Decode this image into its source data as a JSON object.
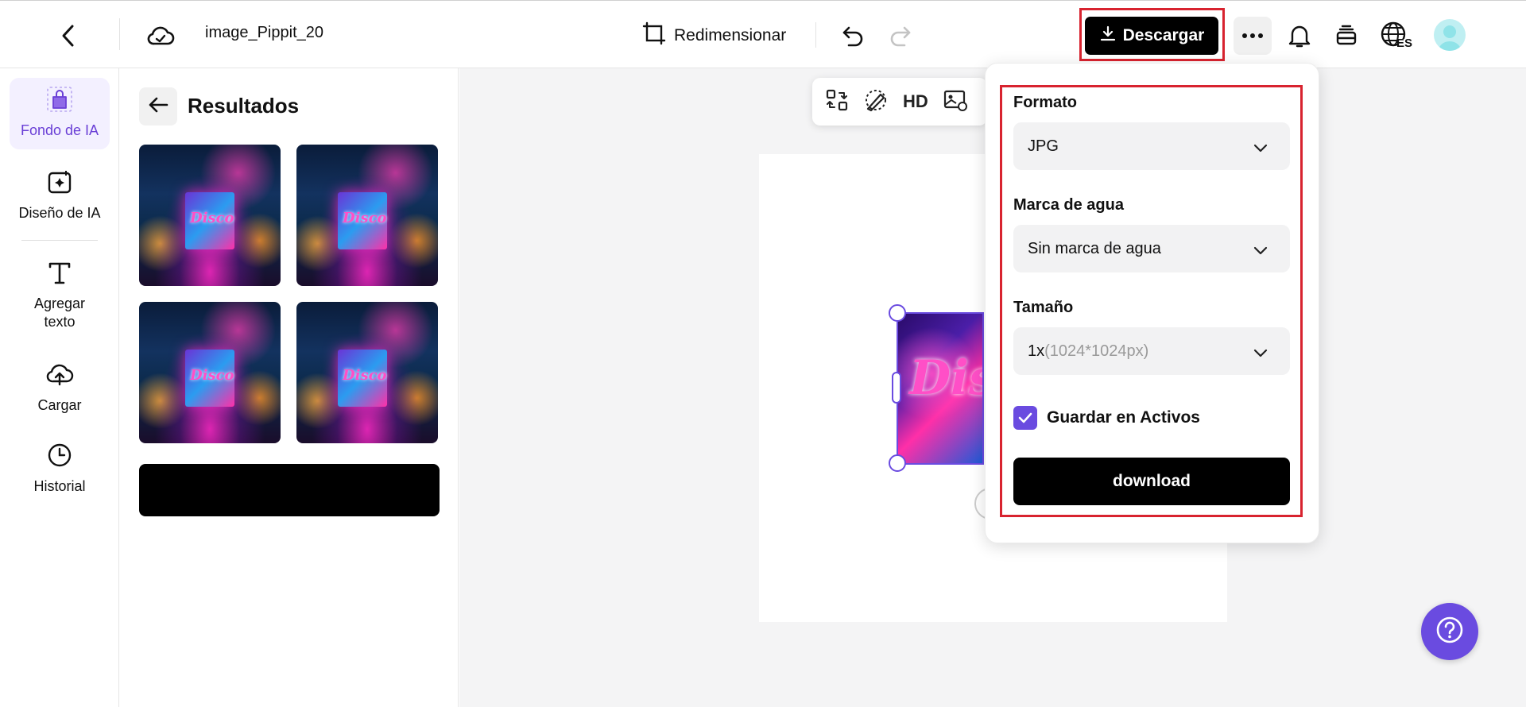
{
  "topbar": {
    "file_name": "image_Pippit_20",
    "resize_label": "Redimensionar",
    "download_label": "Descargar",
    "language_badge": "ES"
  },
  "rail": {
    "items": [
      {
        "label": "Fondo de IA",
        "icon": "bag-icon",
        "active": true
      },
      {
        "label": "Diseño de IA",
        "icon": "ai-design-icon"
      },
      {
        "label": "Agregar texto",
        "icon": "text-icon"
      },
      {
        "label": "Cargar",
        "icon": "cloud-upload-icon"
      },
      {
        "label": "Historial",
        "icon": "clock-icon"
      }
    ]
  },
  "panel": {
    "title": "Resultados",
    "thumb_text": "Disco"
  },
  "canvas": {
    "toolbar_hd": "HD",
    "image_text": "Disc"
  },
  "download_menu": {
    "format_label": "Formato",
    "format_value": "JPG",
    "watermark_label": "Marca de agua",
    "watermark_value": "Sin marca de agua",
    "size_label": "Tamaño",
    "size_value": "1x",
    "size_detail": "(1024*1024px)",
    "save_assets_label": "Guardar en Activos",
    "save_assets_checked": true,
    "download_button": "download"
  },
  "colors": {
    "accent": "#6a4be0",
    "highlight_red": "#d8232f",
    "primary_button": "#000000"
  }
}
